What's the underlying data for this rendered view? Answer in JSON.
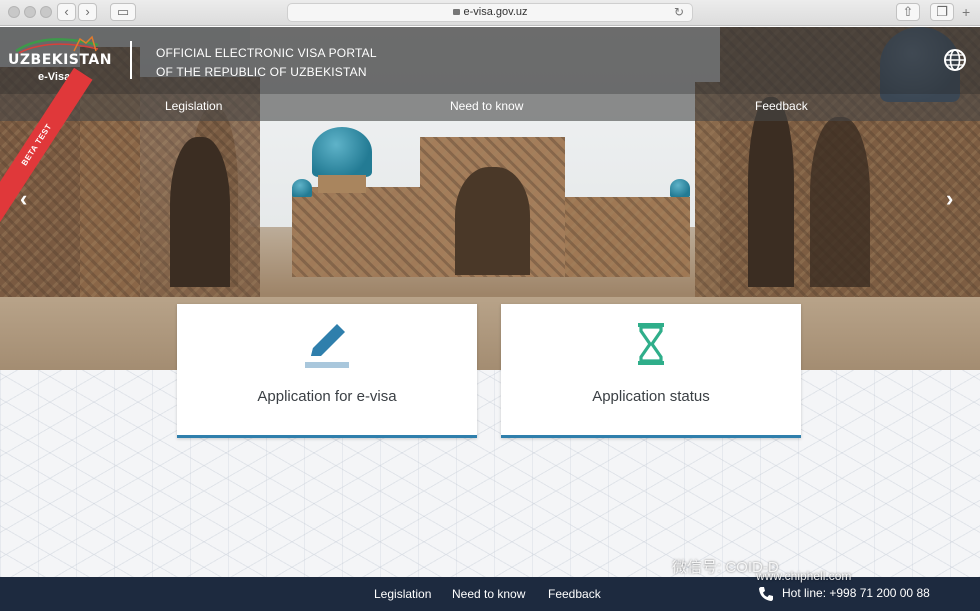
{
  "browser": {
    "url": "e-visa.gov.uz"
  },
  "header": {
    "logo_text": "UZBEKISTAN",
    "logo_sub": "e-Visa",
    "portal_title_line1": "OFFICIAL ELECTRONIC VISA PORTAL",
    "portal_title_line2": "OF THE REPUBLIC OF UZBEKISTAN",
    "language_icon": "globe-icon"
  },
  "nav": {
    "items": [
      {
        "label": "Legislation"
      },
      {
        "label": "Need to know"
      },
      {
        "label": "Feedback"
      }
    ]
  },
  "hero": {
    "beta_label": "BETA TEST",
    "prev_icon": "chevron-left-icon",
    "next_icon": "chevron-right-icon"
  },
  "cards": [
    {
      "label": "Application for e-visa",
      "icon": "pencil-icon",
      "accent": "#2f7fac"
    },
    {
      "label": "Application status",
      "icon": "hourglass-icon",
      "accent": "#2fae8a"
    }
  ],
  "footer": {
    "links": [
      {
        "label": "Legislation"
      },
      {
        "label": "Need to know"
      },
      {
        "label": "Feedback"
      }
    ],
    "hotline": "Hot line: +998 71 200 00 88"
  },
  "watermark": {
    "text1": "微信号: COID-D",
    "text2": "www.chiphell.com"
  },
  "colors": {
    "footer_bg": "#1d2a3f",
    "card_border": "#2f7fac",
    "beta_red": "#e0383a"
  }
}
